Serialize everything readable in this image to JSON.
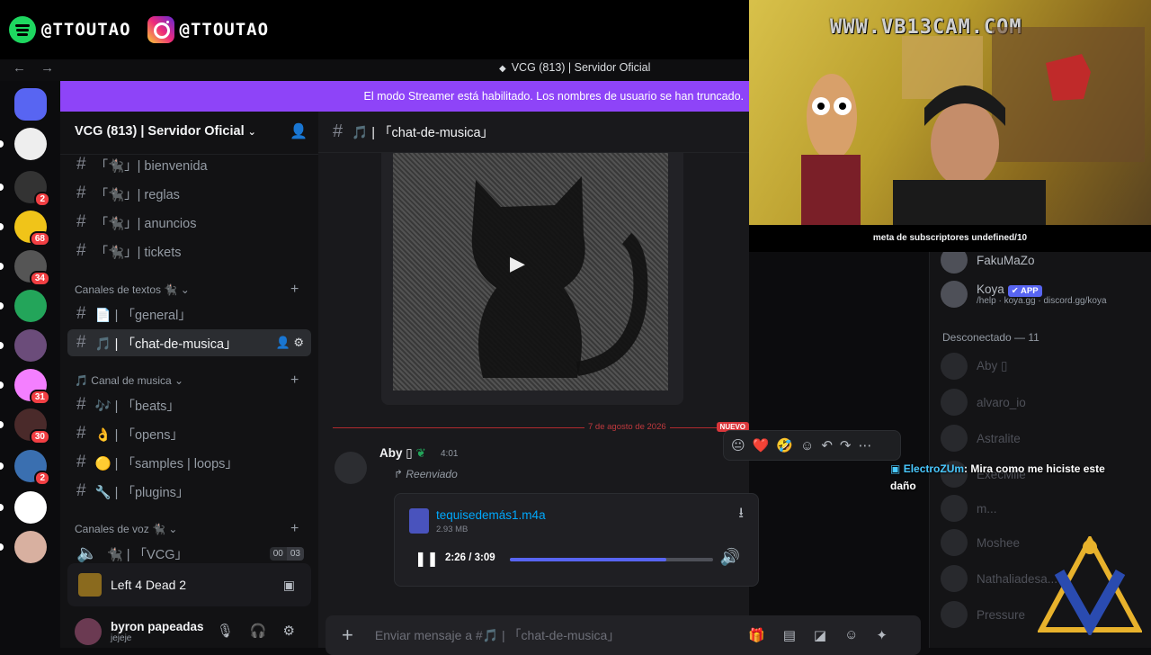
{
  "social": {
    "spotify_handle": "@TTOUTAO",
    "instagram_handle": "@TTOUTAO"
  },
  "window": {
    "title": "VCG (813) | Servidor Oficial",
    "nav_arrows": "← →"
  },
  "banner": {
    "text": "El modo Streamer está habilitado. Los nombres de usuario se han truncado."
  },
  "guilds": [
    {
      "icon": "discord-home-icon"
    },
    {
      "icon": "server-vcg-icon"
    },
    {
      "icon": "server-icon",
      "badge": "2"
    },
    {
      "icon": "server-icon",
      "badge": "68"
    },
    {
      "icon": "server-icon",
      "badge": "34"
    },
    {
      "icon": "server-icon"
    },
    {
      "icon": "server-icon"
    },
    {
      "icon": "server-icon",
      "badge": "31"
    },
    {
      "icon": "server-icon",
      "badge": "30"
    },
    {
      "icon": "server-icon",
      "badge": "2"
    },
    {
      "icon": "server-icon"
    },
    {
      "icon": "server-icon"
    }
  ],
  "sidebar": {
    "server_name": "VCG (813) | Servidor Oficial",
    "channels_top": [
      {
        "label": "「🐈‍⬛」| bienvenida"
      },
      {
        "label": "「🐈‍⬛」| reglas"
      },
      {
        "label": "「🐈‍⬛」| anuncios"
      },
      {
        "label": "「🐈‍⬛」| tickets"
      }
    ],
    "cat_text": "Canales de textos 🐈‍⬛",
    "channels_text": [
      {
        "label": "📄 | 「general」"
      },
      {
        "label": "🎵 | 「chat-de-musica」",
        "selected": true
      }
    ],
    "cat_music": "🎵 Canal de musica",
    "channels_music": [
      {
        "label": "🎶 | 「beats」"
      },
      {
        "label": "👌 | 「opens」"
      },
      {
        "label": "🟡 | 「samples | loops」"
      },
      {
        "label": "🔧 | 「plugins」"
      }
    ],
    "cat_voice": "Canales de voz 🐈‍⬛",
    "voice_channel": "🐈‍⬛ | 「VCG」",
    "voice_counts": [
      "00",
      "03"
    ],
    "activity": "Left 4 Dead 2",
    "user": {
      "name": "byron papeadas",
      "status": "jejeje"
    }
  },
  "chat": {
    "channel_name": "🎵 | 「chat-de-musica」",
    "date_divider": "7 de agosto de 2026",
    "new_badge": "NUEVO",
    "message": {
      "author": "Aby ▯",
      "time": "4:01",
      "forwarded": "Reenviado",
      "file": {
        "name": "tequisedemás1.m4a",
        "size": "2.93 MB",
        "current": "2:26",
        "total": "3:09",
        "progress_fraction": 0.77
      }
    },
    "reactions": [
      "😐",
      "❤️",
      "🤣"
    ],
    "composer_placeholder": "Enviar mensaje a #🎵 | 「chat-de-musica」"
  },
  "members": {
    "online": [
      {
        "name": "FakuMaZo"
      },
      {
        "name": "Koya",
        "tag": "APP",
        "sub": "/help · koya.gg · discord.gg/koya"
      }
    ],
    "offline_header": "Desconectado — 11",
    "offline": [
      {
        "name": "Aby ▯"
      },
      {
        "name": "alvaro_io"
      },
      {
        "name": "Astralite"
      },
      {
        "name": "ExecMile"
      },
      {
        "name": "m..."
      },
      {
        "name": "Moshee"
      },
      {
        "name": "Nathaliadesa..."
      },
      {
        "name": "Pressure"
      }
    ]
  },
  "stream": {
    "cam_title": "WWW.VB13CAM.COM",
    "meta_text": "meta de subscriptores undefined/10",
    "chat_user": "ElectroZUm",
    "chat_text": ": Mira como me hiciste este daño"
  },
  "colors": {
    "accent": "#5865f2",
    "banner": "#8e44f8",
    "link": "#00a8fc",
    "divider": "#b12a2f"
  }
}
